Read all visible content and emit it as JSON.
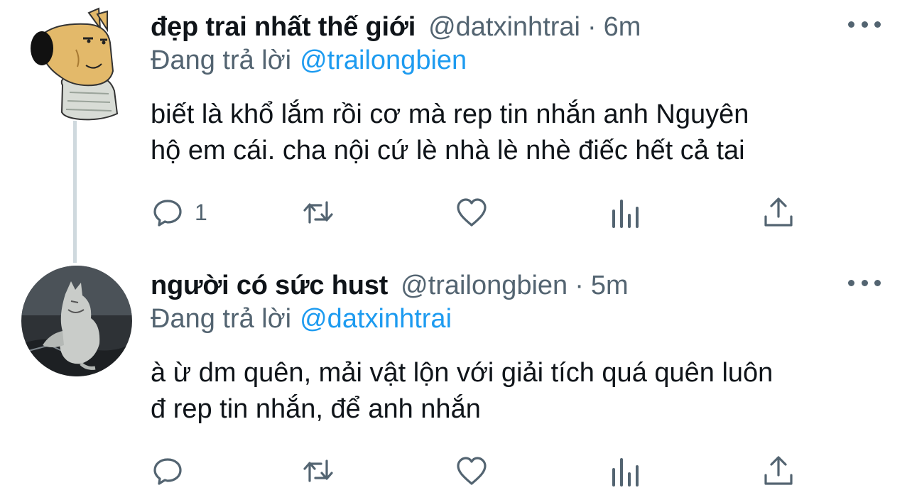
{
  "tweets": [
    {
      "display_name": "đẹp trai nhất thế giới",
      "handle": "@datxinhtrai",
      "separator": "·",
      "time": "6m",
      "replying_prefix": "Đang trả lời",
      "replying_to": "@trailongbien",
      "text_line1": "biết là khổ lắm rồi cơ mà rep tin nhắn anh Nguyên",
      "text_line2": "hộ em cái. cha nội cứ lè nhà lè nhè điếc hết cả tai",
      "reply_count": "1",
      "avatar_icon": "cartoon-dog-avatar"
    },
    {
      "display_name": "người có sức hust",
      "handle": "@trailongbien",
      "separator": "·",
      "time": "5m",
      "replying_prefix": "Đang trả lời",
      "replying_to": "@datxinhtrai",
      "text_line1": "à ừ dm quên, mải vật lộn với giải tích quá quên luôn",
      "text_line2": "đ rep tin nhắn, để anh nhắn",
      "reply_count": "",
      "avatar_icon": "wolf-avatar"
    }
  ],
  "colors": {
    "text": "#0f1419",
    "secondary": "#536471",
    "link": "#1d9bf0",
    "thread_line": "#cfd9de"
  },
  "icons": [
    "reply-icon",
    "retweet-icon",
    "like-icon",
    "views-icon",
    "share-icon",
    "more-icon"
  ]
}
